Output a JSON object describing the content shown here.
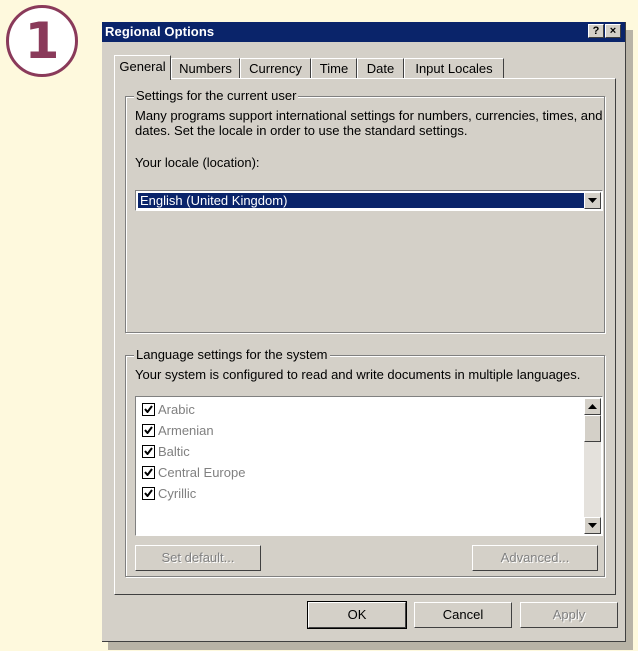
{
  "step_badge": "1",
  "dialog": {
    "title": "Regional Options",
    "help_glyph": "?",
    "close_glyph": "×"
  },
  "tabs": [
    {
      "label": "General",
      "active": true
    },
    {
      "label": "Numbers"
    },
    {
      "label": "Currency"
    },
    {
      "label": "Time"
    },
    {
      "label": "Date"
    },
    {
      "label": "Input Locales"
    }
  ],
  "user_settings": {
    "group_label": "Settings for the current user",
    "description": "Many programs support international settings for numbers, currencies, times, and dates. Set the locale in order to use the standard settings.",
    "locale_label": "Your locale (location):",
    "locale_value": "English (United Kingdom)"
  },
  "system_settings": {
    "group_label": "Language settings for the system",
    "description": "Your system is configured to read and write documents in multiple languages.",
    "languages": [
      {
        "label": "Arabic",
        "checked": true
      },
      {
        "label": "Armenian",
        "checked": true
      },
      {
        "label": "Baltic",
        "checked": true
      },
      {
        "label": "Central Europe",
        "checked": true
      },
      {
        "label": "Cyrillic",
        "checked": true
      }
    ],
    "set_default_label": "Set default...",
    "advanced_label": "Advanced..."
  },
  "footer": {
    "ok_label": "OK",
    "cancel_label": "Cancel",
    "apply_label": "Apply"
  },
  "colors": {
    "titlebar": "#0a246a",
    "dialog_face": "#d4d0c8",
    "badge": "#8a3a5a",
    "page_background": "#fef9dd"
  }
}
